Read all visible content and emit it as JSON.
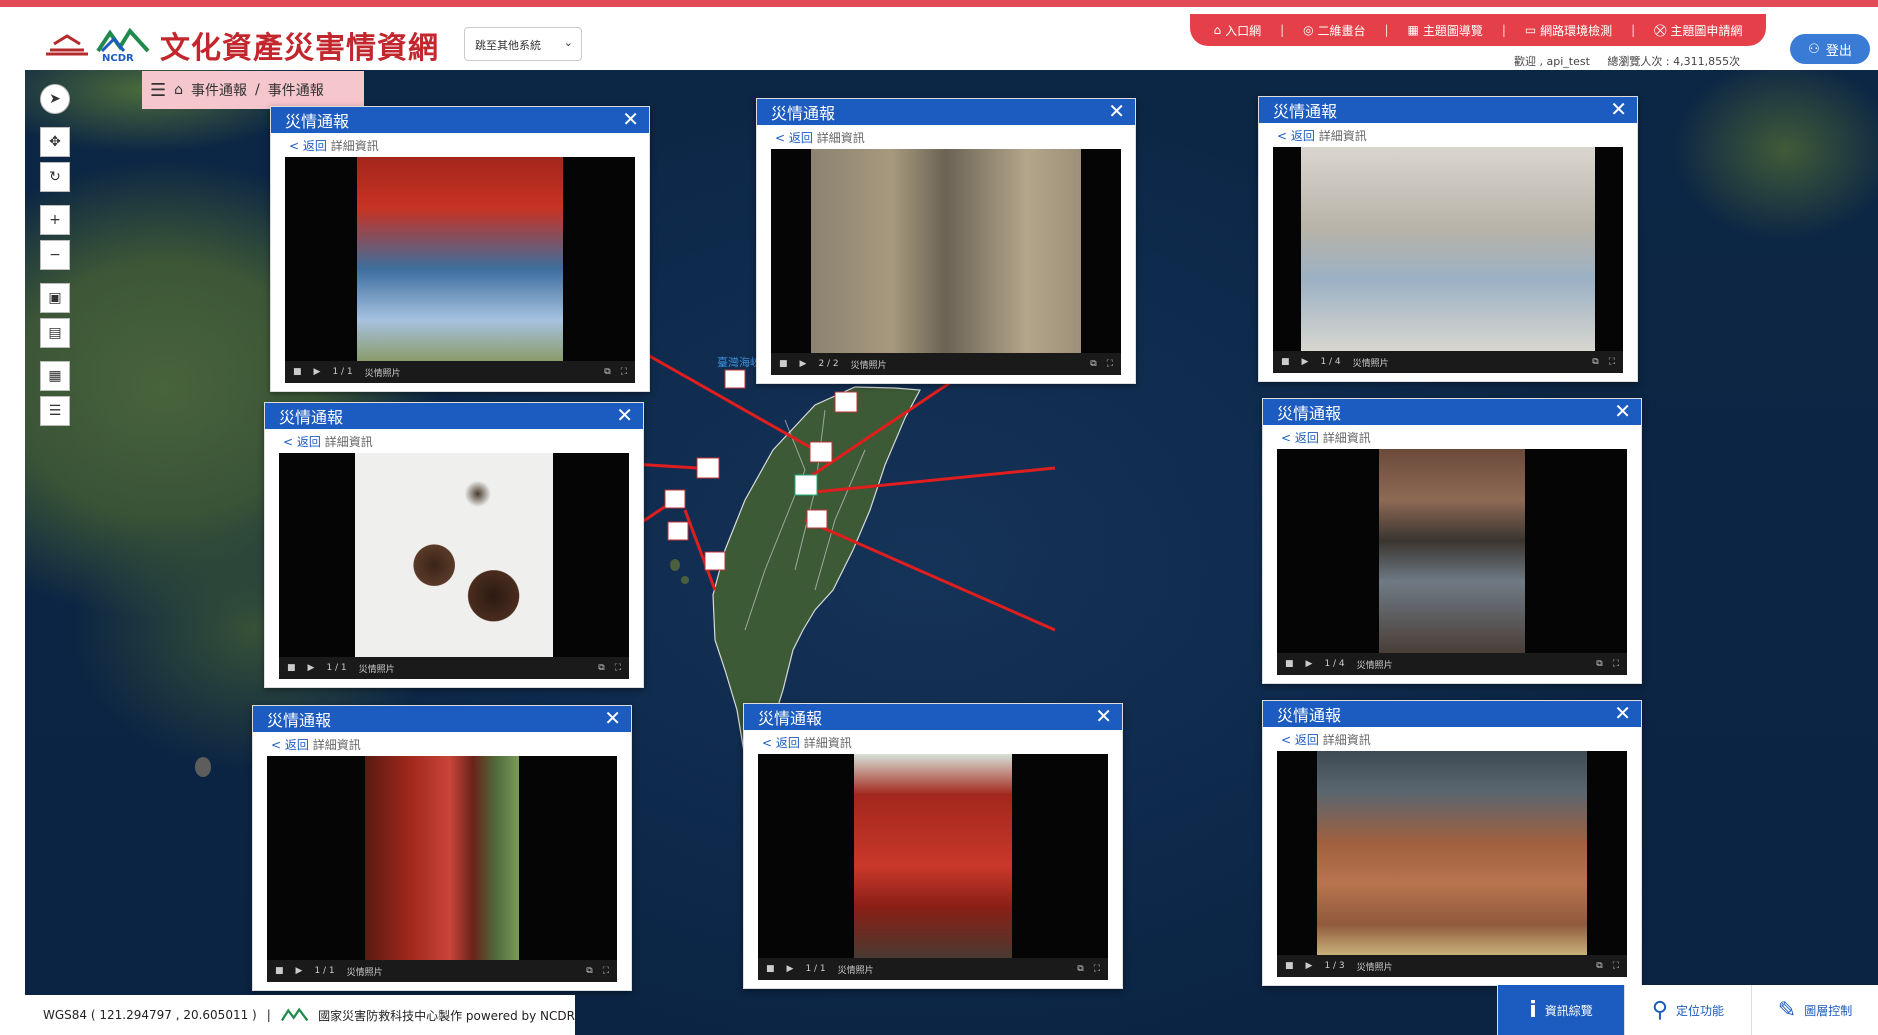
{
  "header": {
    "site_title": "文化資產災害情資網",
    "logo_text": "NCDR",
    "system_select": "跳至其他系統",
    "nav": [
      {
        "label": "入口網",
        "icon": "home-icon"
      },
      {
        "label": "二維畫台",
        "icon": "map-icon"
      },
      {
        "label": "主題圖導覽",
        "icon": "grid-icon"
      },
      {
        "label": "網路環境檢測",
        "icon": "monitor-icon"
      },
      {
        "label": "主題圖申請網",
        "icon": "cart-icon"
      }
    ],
    "user": "歡迎 , api_test",
    "visitors": "總瀏覽人次 : 4,311,855次",
    "logout": "登出"
  },
  "breadcrumb": {
    "home": "事件通報",
    "current": "事件通報"
  },
  "map_labels": {
    "strait": "臺灣海峽"
  },
  "popup_common": {
    "title": "災情通報",
    "back": "返回",
    "detail": "詳細資訊",
    "photo_label": "災情照片"
  },
  "popups": [
    {
      "id": "p1",
      "counter": "1 / 1"
    },
    {
      "id": "p2",
      "counter": "2 / 2"
    },
    {
      "id": "p3",
      "counter": "1 / 4"
    },
    {
      "id": "p4",
      "counter": "1 / 1"
    },
    {
      "id": "p5",
      "counter": "1 / 4"
    },
    {
      "id": "p6",
      "counter": "1 / 1"
    },
    {
      "id": "p7",
      "counter": "1 / 1"
    },
    {
      "id": "p8",
      "counter": "1 / 3"
    }
  ],
  "footer": {
    "coords": "WGS84 ( 121.294797 , 20.605011 )",
    "credit": "國家災害防救科技中心製作 powered by NCDR"
  },
  "bottom_tabs": [
    {
      "label": "資訊綜覽",
      "icon": "info-icon"
    },
    {
      "label": "定位功能",
      "icon": "pin-icon"
    },
    {
      "label": "圖層控制",
      "icon": "edit-icon"
    }
  ]
}
